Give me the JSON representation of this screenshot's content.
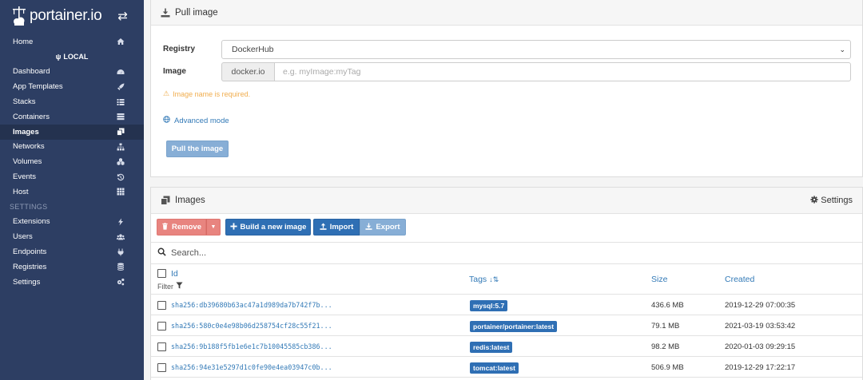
{
  "brand": {
    "logo_text": "portainer.io"
  },
  "sidebar": {
    "home": "Home",
    "endpoint": "LOCAL",
    "items": [
      {
        "label": "Dashboard",
        "icon": "tachometer-icon"
      },
      {
        "label": "App Templates",
        "icon": "rocket-icon"
      },
      {
        "label": "Stacks",
        "icon": "th-list-icon"
      },
      {
        "label": "Containers",
        "icon": "server-icon"
      },
      {
        "label": "Images",
        "icon": "clone-icon",
        "active": true
      },
      {
        "label": "Networks",
        "icon": "sitemap-icon"
      },
      {
        "label": "Volumes",
        "icon": "cubes-icon"
      },
      {
        "label": "Events",
        "icon": "history-icon"
      },
      {
        "label": "Host",
        "icon": "th-icon"
      }
    ],
    "settings_title": "SETTINGS",
    "settings_items": [
      {
        "label": "Extensions",
        "icon": "bolt-icon"
      },
      {
        "label": "Users",
        "icon": "users-icon"
      },
      {
        "label": "Endpoints",
        "icon": "plug-icon"
      },
      {
        "label": "Registries",
        "icon": "database-icon"
      },
      {
        "label": "Settings",
        "icon": "cogs-icon"
      }
    ]
  },
  "pull": {
    "title": "Pull image",
    "registry_label": "Registry",
    "registry_value": "DockerHub",
    "image_label": "Image",
    "image_prefix": "docker.io",
    "image_placeholder": "e.g. myImage:myTag",
    "warning": "Image name is required.",
    "advanced_mode": "Advanced mode",
    "pull_button": "Pull the image"
  },
  "images": {
    "title": "Images",
    "settings_label": "Settings",
    "remove_label": "Remove",
    "build_label": "Build a new image",
    "import_label": "Import",
    "export_label": "Export",
    "search_placeholder": "Search...",
    "columns": {
      "id": "Id",
      "filter": "Filter",
      "tags": "Tags",
      "size": "Size",
      "created": "Created"
    },
    "rows": [
      {
        "id": "sha256:db39680b63ac47a1d989da7b742f7b...",
        "tag": "mysql:5.7",
        "size": "436.6 MB",
        "created": "2019-12-29 07:00:35"
      },
      {
        "id": "sha256:580c0e4e98b06d258754cf28c55f21...",
        "tag": "portainer/portainer:latest",
        "size": "79.1 MB",
        "created": "2021-03-19 03:53:42"
      },
      {
        "id": "sha256:9b188f5fb1e6e1c7b10045585cb386...",
        "tag": "redis:latest",
        "size": "98.2 MB",
        "created": "2020-01-03 09:29:15"
      },
      {
        "id": "sha256:94e31e5297d1c0fe90e4ea03947c0b...",
        "tag": "tomcat:latest",
        "size": "506.9 MB",
        "created": "2019-12-29 17:22:17"
      }
    ]
  },
  "colors": {
    "sidebar": "#2d3e63",
    "primary": "#2f6fb4",
    "danger": "#e8847f",
    "warning": "#f0ad4e"
  }
}
